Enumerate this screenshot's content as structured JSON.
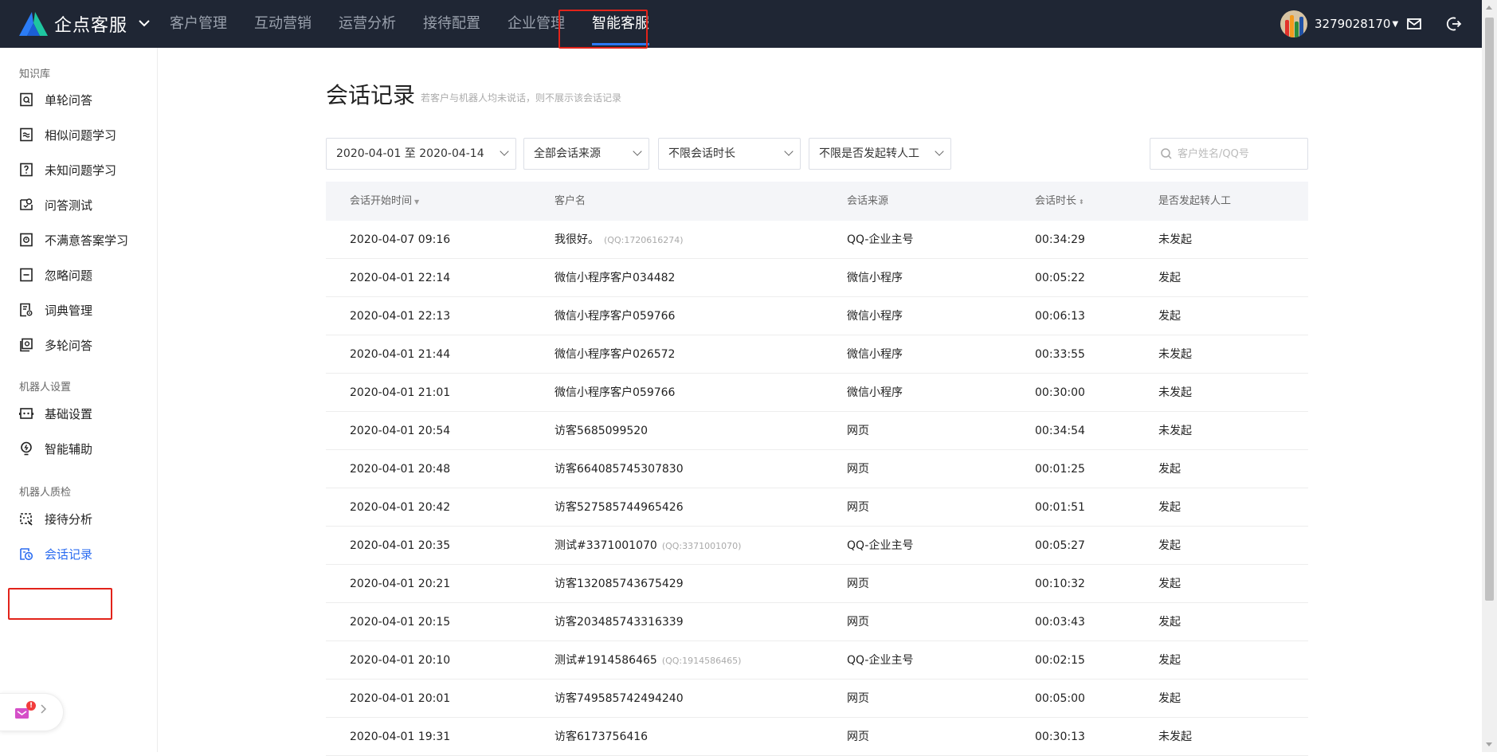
{
  "header": {
    "brand": "企点客服",
    "nav": [
      "客户管理",
      "互动营销",
      "运营分析",
      "接待配置",
      "企业管理",
      "智能客服"
    ],
    "active_nav": "智能客服",
    "user": "3279028170"
  },
  "sidebar": {
    "groups": [
      {
        "title": "知识库",
        "items": [
          "单轮问答",
          "相似问题学习",
          "未知问题学习",
          "问答测试",
          "不满意答案学习",
          "忽略问题",
          "词典管理",
          "多轮问答"
        ]
      },
      {
        "title": "机器人设置",
        "items": [
          "基础设置",
          "智能辅助"
        ]
      },
      {
        "title": "机器人质检",
        "items": [
          "接待分析",
          "会话记录"
        ]
      }
    ],
    "active_item": "会话记录",
    "fab_badge": "!"
  },
  "page": {
    "title": "会话记录",
    "subtitle": "若客户与机器人均未说话，则不展示该会话记录"
  },
  "filters": {
    "date_range": "2020-04-01 至 2020-04-14",
    "source": "全部会话来源",
    "duration": "不限会话时长",
    "transfer": "不限是否发起转人工",
    "search_placeholder": "客户姓名/QQ号"
  },
  "table": {
    "columns": [
      "会话开始时间",
      "客户名",
      "会话来源",
      "会话时长",
      "是否发起转人工"
    ],
    "rows": [
      {
        "time": "2020-04-07 09:16",
        "name": "我很好。",
        "qq": "(QQ:1720616274)",
        "source": "QQ-企业主号",
        "duration": "00:34:29",
        "transfer": "未发起"
      },
      {
        "time": "2020-04-01 22:14",
        "name": "微信小程序客户034482",
        "qq": "",
        "source": "微信小程序",
        "duration": "00:05:22",
        "transfer": "发起"
      },
      {
        "time": "2020-04-01 22:13",
        "name": "微信小程序客户059766",
        "qq": "",
        "source": "微信小程序",
        "duration": "00:06:13",
        "transfer": "发起"
      },
      {
        "time": "2020-04-01 21:44",
        "name": "微信小程序客户026572",
        "qq": "",
        "source": "微信小程序",
        "duration": "00:33:55",
        "transfer": "未发起"
      },
      {
        "time": "2020-04-01 21:01",
        "name": "微信小程序客户059766",
        "qq": "",
        "source": "微信小程序",
        "duration": "00:30:00",
        "transfer": "未发起"
      },
      {
        "time": "2020-04-01 20:54",
        "name": "访客5685099520",
        "qq": "",
        "source": "网页",
        "duration": "00:34:54",
        "transfer": "未发起"
      },
      {
        "time": "2020-04-01 20:48",
        "name": "访客664085745307830",
        "qq": "",
        "source": "网页",
        "duration": "00:01:25",
        "transfer": "发起"
      },
      {
        "time": "2020-04-01 20:42",
        "name": "访客527585744965426",
        "qq": "",
        "source": "网页",
        "duration": "00:01:51",
        "transfer": "发起"
      },
      {
        "time": "2020-04-01 20:35",
        "name": "测试#3371001070",
        "qq": "(QQ:3371001070)",
        "source": "QQ-企业主号",
        "duration": "00:05:27",
        "transfer": "发起"
      },
      {
        "time": "2020-04-01 20:21",
        "name": "访客132085743675429",
        "qq": "",
        "source": "网页",
        "duration": "00:10:32",
        "transfer": "发起"
      },
      {
        "time": "2020-04-01 20:15",
        "name": "访客203485743316339",
        "qq": "",
        "source": "网页",
        "duration": "00:03:43",
        "transfer": "发起"
      },
      {
        "time": "2020-04-01 20:10",
        "name": "测试#1914586465",
        "qq": "(QQ:1914586465)",
        "source": "QQ-企业主号",
        "duration": "00:02:15",
        "transfer": "发起"
      },
      {
        "time": "2020-04-01 20:01",
        "name": "访客749585742494240",
        "qq": "",
        "source": "网页",
        "duration": "00:05:00",
        "transfer": "发起"
      },
      {
        "time": "2020-04-01 19:31",
        "name": "访客6173756416",
        "qq": "",
        "source": "网页",
        "duration": "00:30:13",
        "transfer": "未发起"
      }
    ]
  },
  "colors": {
    "topbar": "#1f2634",
    "accent": "#2b6cf0",
    "highlight_box": "#e2231a"
  }
}
